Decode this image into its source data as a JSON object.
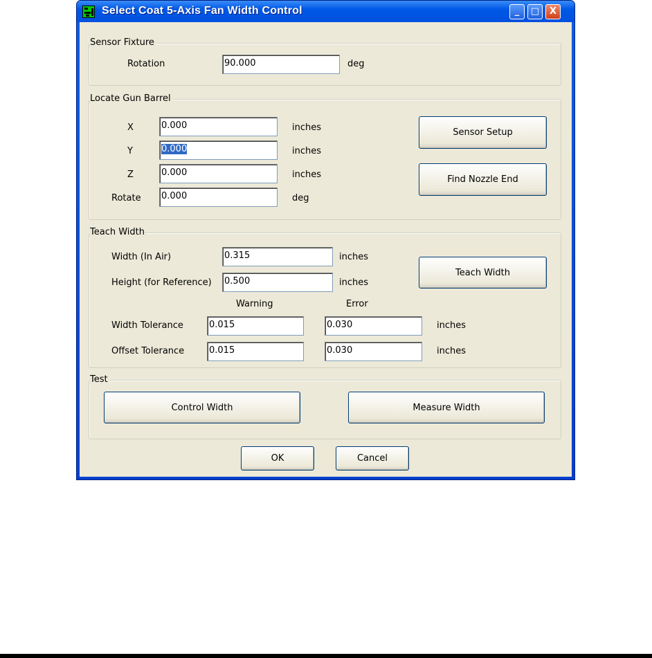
{
  "window": {
    "title": "Select Coat 5-Axis Fan Width Control",
    "minimize": "_",
    "maximize": "□",
    "close": "X"
  },
  "sensor_fixture": {
    "label": "Sensor Fixture",
    "rotation_label": "Rotation",
    "rotation_value": "90.000",
    "rotation_unit": "deg"
  },
  "locate_gun_barrel": {
    "label": "Locate Gun Barrel",
    "fields": [
      {
        "label": "X",
        "value": "0.000",
        "unit": "inches"
      },
      {
        "label": "Y",
        "value": "0.000",
        "unit": "inches"
      },
      {
        "label": "Z",
        "value": "0.000",
        "unit": "inches"
      },
      {
        "label": "Rotate",
        "value": "0.000",
        "unit": "deg"
      }
    ],
    "sensor_setup": "Sensor Setup",
    "find_nozzle_end": "Find Nozzle End"
  },
  "teach_width": {
    "label": "Teach Width",
    "width_label": "Width (In Air)",
    "width_value": "0.315",
    "width_unit": "inches",
    "height_label": "Height (for Reference)",
    "height_value": "0.500",
    "height_unit": "inches",
    "teach_button": "Teach Width",
    "warning_header": "Warning",
    "error_header": "Error",
    "width_tol_label": "Width Tolerance",
    "width_tol_warning": "0.015",
    "width_tol_error": "0.030",
    "width_tol_unit": "inches",
    "offset_tol_label": "Offset Tolerance",
    "offset_tol_warning": "0.015",
    "offset_tol_error": "0.030",
    "offset_tol_unit": "inches"
  },
  "test": {
    "label": "Test",
    "control_width": "Control Width",
    "measure_width": "Measure Width"
  },
  "footer": {
    "ok": "OK",
    "cancel": "Cancel"
  }
}
